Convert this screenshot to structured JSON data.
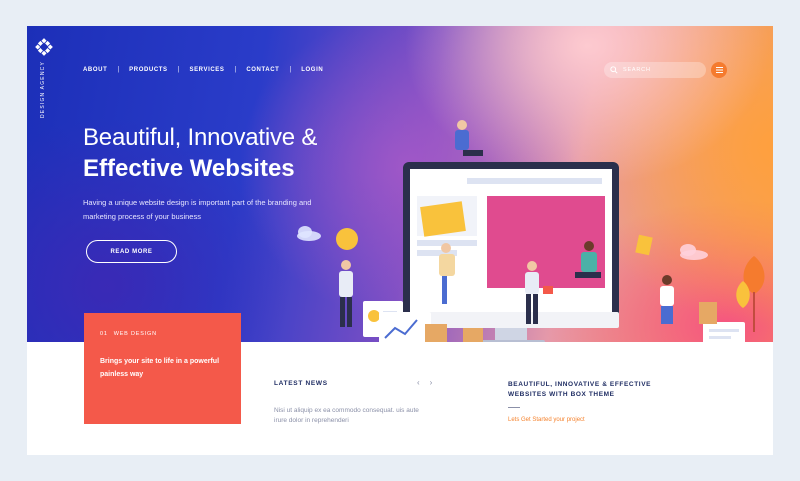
{
  "brand": {
    "vertical_text": "DESIGN AGENCY",
    "logo": "diamond-x-logo"
  },
  "nav": {
    "items": [
      {
        "label": "ABOUT"
      },
      {
        "label": "PRODUCTS"
      },
      {
        "label": "SERVICES"
      },
      {
        "label": "CONTACT"
      },
      {
        "label": "LOGIN"
      }
    ],
    "separator": "|"
  },
  "search": {
    "placeholder": "SEARCH",
    "icon": "search-icon"
  },
  "menu": {
    "icon": "hamburger-icon"
  },
  "hero": {
    "title_line1": "Beautiful, Innovative &",
    "title_line2": "Effective Websites",
    "description": "Having a unique website design is important part of the branding and marketing process of your business",
    "cta_label": "READ MORE"
  },
  "feature_card": {
    "number": "01",
    "category": "WEB DESIGN",
    "tagline": "Brings your site to life in a powerful painless way"
  },
  "news": {
    "title": "LATEST NEWS",
    "text": "Nisi ut aliquip ex ea commodo consequat. uis aute irure dolor in reprehenderi",
    "prev_icon": "chevron-left-icon",
    "next_icon": "chevron-right-icon",
    "prev": "‹",
    "next": "›"
  },
  "promo": {
    "title": "BEAUTIFUL, INNOVATIVE & EFFECTIVE WEBSITES WITH BOX THEME",
    "link": "Lets Get Started your project"
  },
  "colors": {
    "accent_orange": "#f5832e",
    "card_red": "#f4594a",
    "navy_text": "#1f2d63",
    "hero_blue": "#1c2fb8"
  }
}
